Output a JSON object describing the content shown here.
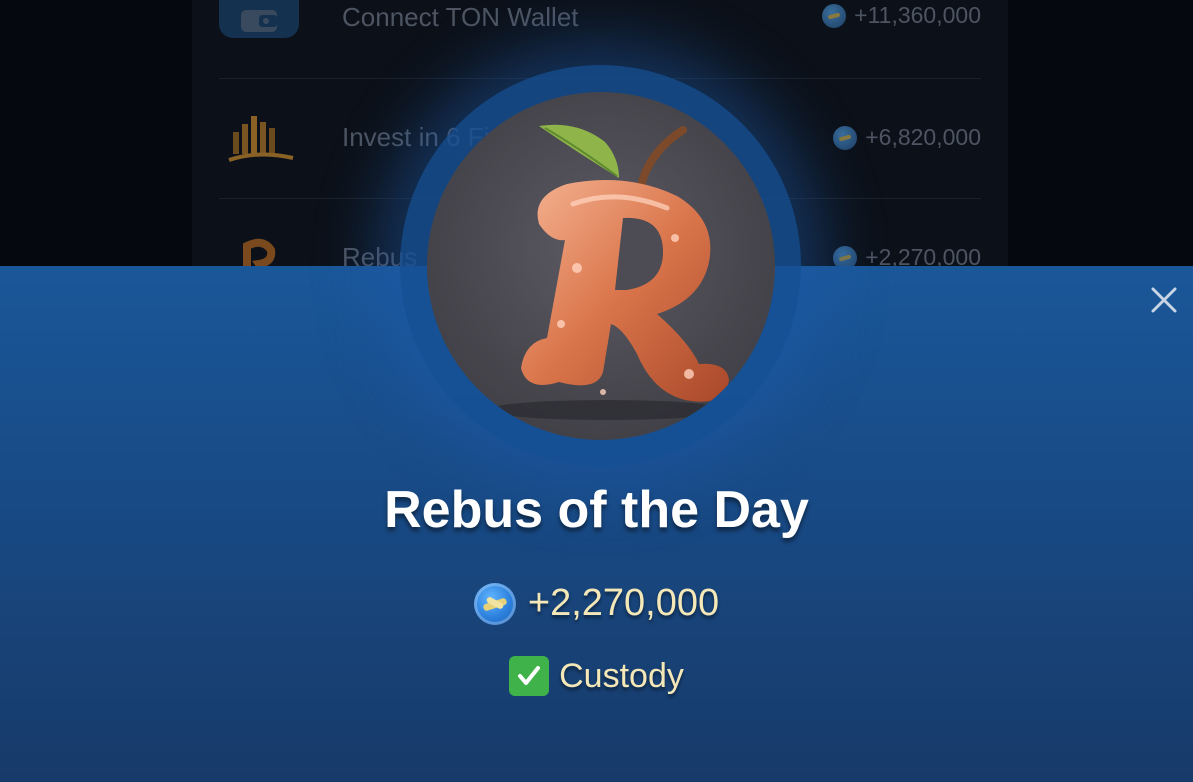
{
  "background_tasks": [
    {
      "title": "Connect TON Wallet",
      "reward": "+11,360,000",
      "icon": "wallet-icon"
    },
    {
      "title": "Invest in 6 Fi",
      "reward": "+6,820,000",
      "icon": "bar-chart-icon"
    },
    {
      "title": "Rebus",
      "reward": "+2,270,000",
      "icon": "apple-r-icon"
    }
  ],
  "modal": {
    "title": "Rebus of the Day",
    "reward": "+2,270,000",
    "coin_icon": "coin-icon",
    "custody_check": "✅",
    "custody_label": "Custody",
    "close_icon": "close-icon",
    "image": "apple-letter-r-image"
  },
  "colors": {
    "modal_top": "#1a5799",
    "modal_bottom": "#173a69",
    "accent_text": "#f4e8b8",
    "check_green": "#3fb34a"
  }
}
